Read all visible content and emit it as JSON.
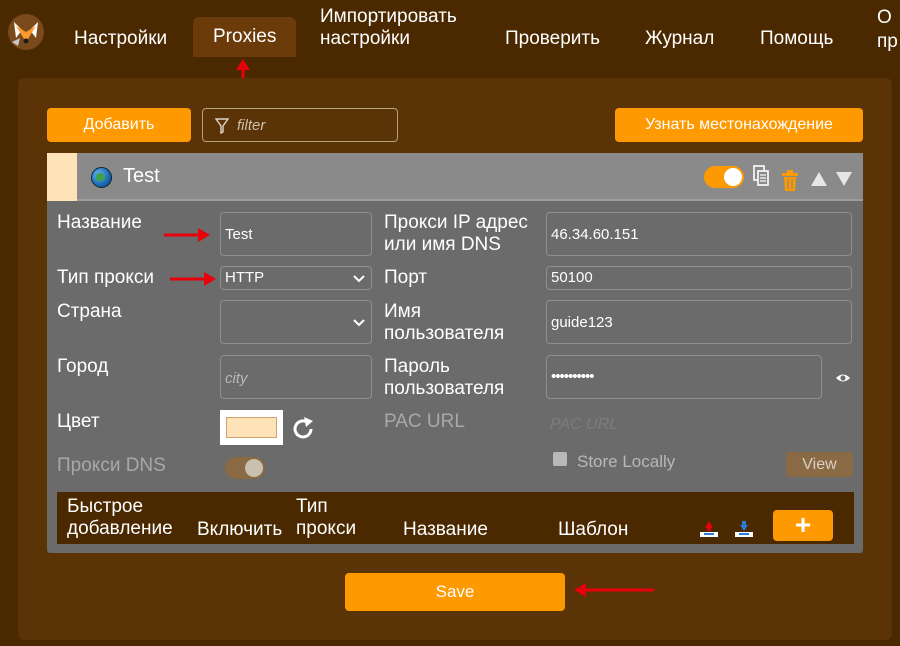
{
  "nav": {
    "tabs": [
      "Настройки",
      "Proxies",
      "Импортировать настройки",
      "Проверить",
      "Журнал",
      "Помощь",
      "О пр"
    ],
    "active_tab": "Proxies"
  },
  "toolbar": {
    "add_label": "Добавить",
    "filter_placeholder": "filter",
    "location_label": "Узнать местонахождение"
  },
  "proxy": {
    "title": "Test",
    "enabled": true,
    "fields": {
      "name_label": "Название",
      "name_value": "Test",
      "type_label": "Тип прокси",
      "type_value": "HTTP",
      "country_label": "Страна",
      "country_value": "",
      "city_label": "Город",
      "city_placeholder": "city",
      "color_label": "Цвет",
      "color_value": "#ffe3b8",
      "dns_label": "Прокси DNS",
      "dns_enabled": false,
      "host_label": "Прокси IP адрес или имя DNS",
      "host_value": "46.34.60.151",
      "port_label": "Порт",
      "port_value": "50100",
      "username_label": "Имя пользователя",
      "username_value": "guide123",
      "password_label": "Пароль пользователя",
      "password_value": "••••••••••",
      "pac_label": "PAC URL",
      "pac_placeholder": "PAC URL",
      "store_locally_label": "Store Locally",
      "store_locally": false,
      "view_label": "View"
    },
    "patterns": {
      "quick_add": "Быстрое добавление",
      "enable": "Включить",
      "type": "Тип прокси",
      "name": "Название",
      "pattern": "Шаблон",
      "add": "+"
    }
  },
  "save_label": "Save",
  "colors": {
    "accent": "#ff9900",
    "background": "#4a2800",
    "panel": "#5a3307",
    "card": "#6b6b6b",
    "proxy_color": "#ffe3b8",
    "annotation": "#e8000b"
  }
}
